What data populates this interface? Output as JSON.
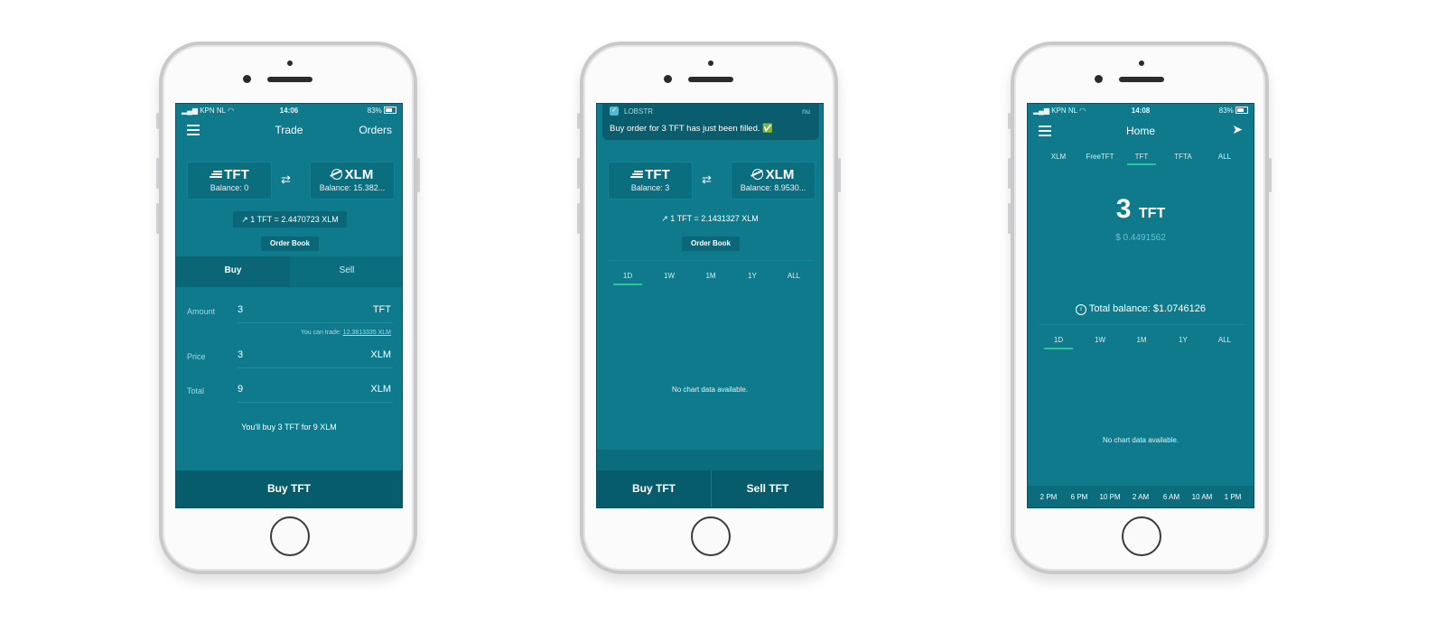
{
  "screen1": {
    "status": {
      "carrier": "KPN NL",
      "time": "14:06",
      "battery": "83%"
    },
    "nav": {
      "title": "Trade",
      "orders": "Orders"
    },
    "from": {
      "currency": "TFT",
      "balance": "Balance: 0"
    },
    "to": {
      "currency": "XLM",
      "balance": "Balance: 15.382..."
    },
    "rate": "1 TFT = 2.4470723 XLM",
    "order_book": "Order Book",
    "tabs": {
      "buy": "Buy",
      "sell": "Sell"
    },
    "form": {
      "amount_label": "Amount",
      "amount_value": "3",
      "amount_unit": "TFT",
      "can_trade": "You can trade:",
      "can_trade_value": "12.3813335 XLM",
      "price_label": "Price",
      "price_value": "3",
      "price_unit": "XLM",
      "total_label": "Total",
      "total_value": "9",
      "total_unit": "XLM"
    },
    "summary": "You'll buy 3 TFT for 9 XLM",
    "button": "Buy TFT"
  },
  "screen2": {
    "notification": {
      "app": "LOBSTR",
      "time": "nu",
      "message": "Buy order for 3 TFT has just been filled. ✅"
    },
    "from": {
      "currency": "TFT",
      "balance": "Balance: 3"
    },
    "to": {
      "currency": "XLM",
      "balance": "Balance: 8.9530..."
    },
    "rate": "1 TFT = 2.1431327 XLM",
    "order_book": "Order Book",
    "periods": [
      "1D",
      "1W",
      "1M",
      "1Y",
      "ALL"
    ],
    "no_data": "No chart data available.",
    "buy_button": "Buy TFT",
    "sell_button": "Sell TFT"
  },
  "screen3": {
    "status": {
      "carrier": "KPN NL",
      "time": "14:08",
      "battery": "83%"
    },
    "nav": {
      "title": "Home"
    },
    "assets": [
      "XLM",
      "FreeTFT",
      "TFT",
      "TFTA",
      "ALL"
    ],
    "amount": "3",
    "unit": "TFT",
    "usd": "$ 0.4491562",
    "total_balance": "Total balance: $1.0746126",
    "periods": [
      "1D",
      "1W",
      "1M",
      "1Y",
      "ALL"
    ],
    "no_data": "No chart data available.",
    "times": [
      "2 PM",
      "6 PM",
      "10 PM",
      "2 AM",
      "6 AM",
      "10 AM",
      "1 PM"
    ]
  },
  "colors": {
    "screen_bg": "#0e7a8c",
    "button_bar": "#075c6b",
    "accent": "#2cc49b"
  }
}
